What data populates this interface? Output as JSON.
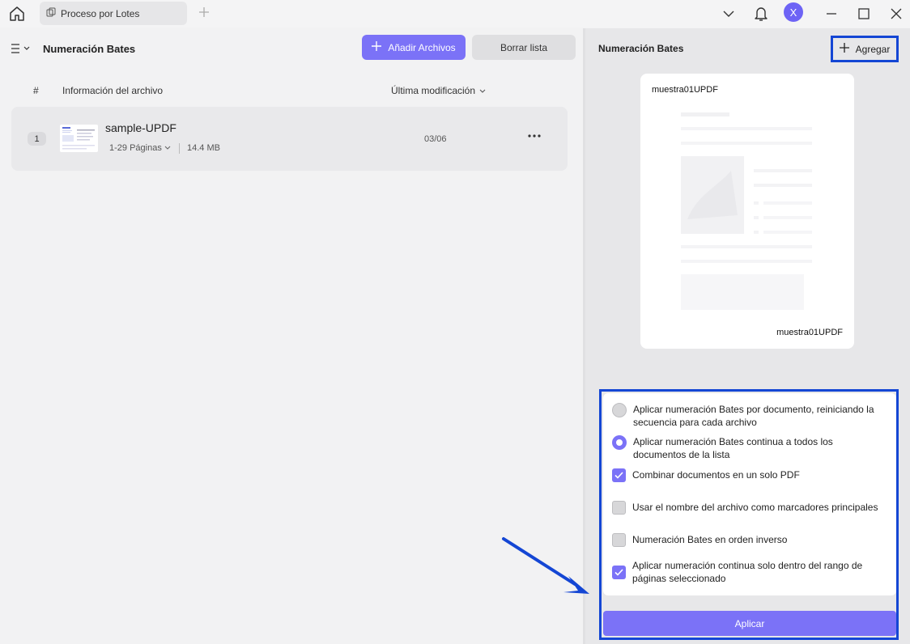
{
  "tabs": {
    "active_label": "Proceso por Lotes"
  },
  "user": {
    "avatar_initial": "X"
  },
  "toolbar": {
    "title": "Numeración Bates",
    "add_files_label": "Añadir Archivos",
    "clear_list_label": "Borrar lista"
  },
  "table": {
    "headers": {
      "index": "#",
      "file_info": "Información del archivo",
      "modified": "Última modificación"
    },
    "rows": [
      {
        "index": "1",
        "name": "sample-UPDF",
        "pages": "1-29 Páginas",
        "size": "14.4 MB",
        "modified": "03/06"
      }
    ]
  },
  "panel": {
    "title": "Numeración Bates",
    "add_label": "Agregar",
    "preview_top_label": "muestra01UPDF",
    "preview_bottom_label": "muestra01UPDF",
    "options": [
      {
        "type": "radio",
        "checked": false,
        "label": "Aplicar numeración Bates por documento, reiniciando la secuencia para cada archivo"
      },
      {
        "type": "radio",
        "checked": true,
        "label": "Aplicar numeración Bates continua a todos los documentos de la lista"
      },
      {
        "type": "checkbox",
        "checked": true,
        "label": "Combinar documentos en un solo PDF"
      },
      {
        "type": "checkbox",
        "checked": false,
        "label": "Usar el nombre del archivo como marcadores principales"
      },
      {
        "type": "checkbox",
        "checked": false,
        "label": "Numeración Bates en orden inverso"
      },
      {
        "type": "checkbox",
        "checked": true,
        "label": "Aplicar numeración continua solo dentro del rango de páginas seleccionado"
      }
    ],
    "apply_label": "Aplicar"
  },
  "colors": {
    "accent": "#7b72f7",
    "highlight": "#1446d4"
  }
}
